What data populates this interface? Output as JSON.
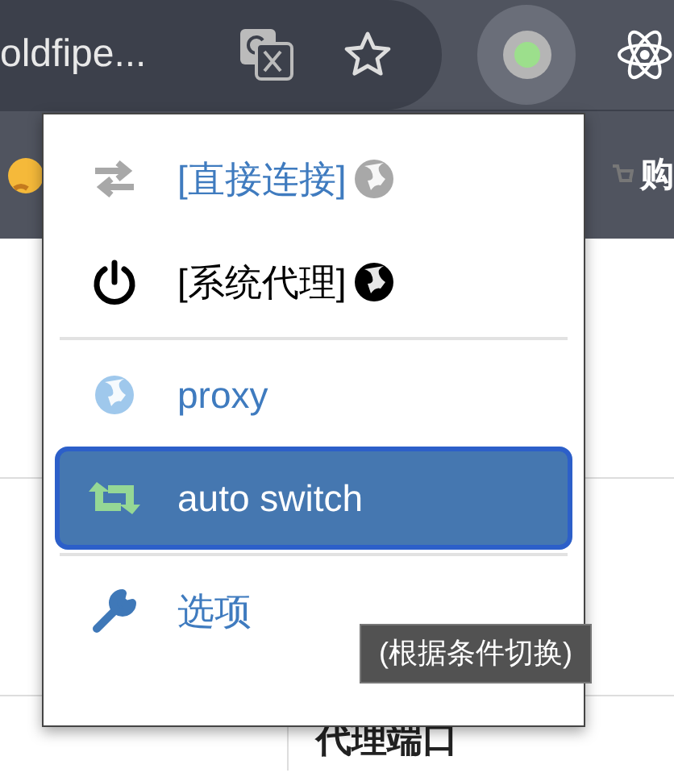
{
  "toolbar": {
    "address_text": "oldfipe...",
    "extension_active": true
  },
  "bookmarks": [
    {
      "label": "购"
    }
  ],
  "page": {
    "heading": "代理端口"
  },
  "menu": {
    "items": [
      {
        "kind": "direct",
        "label": "[直接连接]",
        "selected": false
      },
      {
        "kind": "system",
        "label": "[系统代理]",
        "selected": false
      },
      {
        "kind": "divider"
      },
      {
        "kind": "profile",
        "label": "proxy",
        "color": "#9fc8ec",
        "selected": false
      },
      {
        "kind": "switch",
        "label": "auto switch",
        "color": "#95d795",
        "selected": true
      },
      {
        "kind": "divider"
      },
      {
        "kind": "options",
        "label": "选项",
        "selected": false
      }
    ]
  },
  "tooltip": "(根据条件切换)"
}
